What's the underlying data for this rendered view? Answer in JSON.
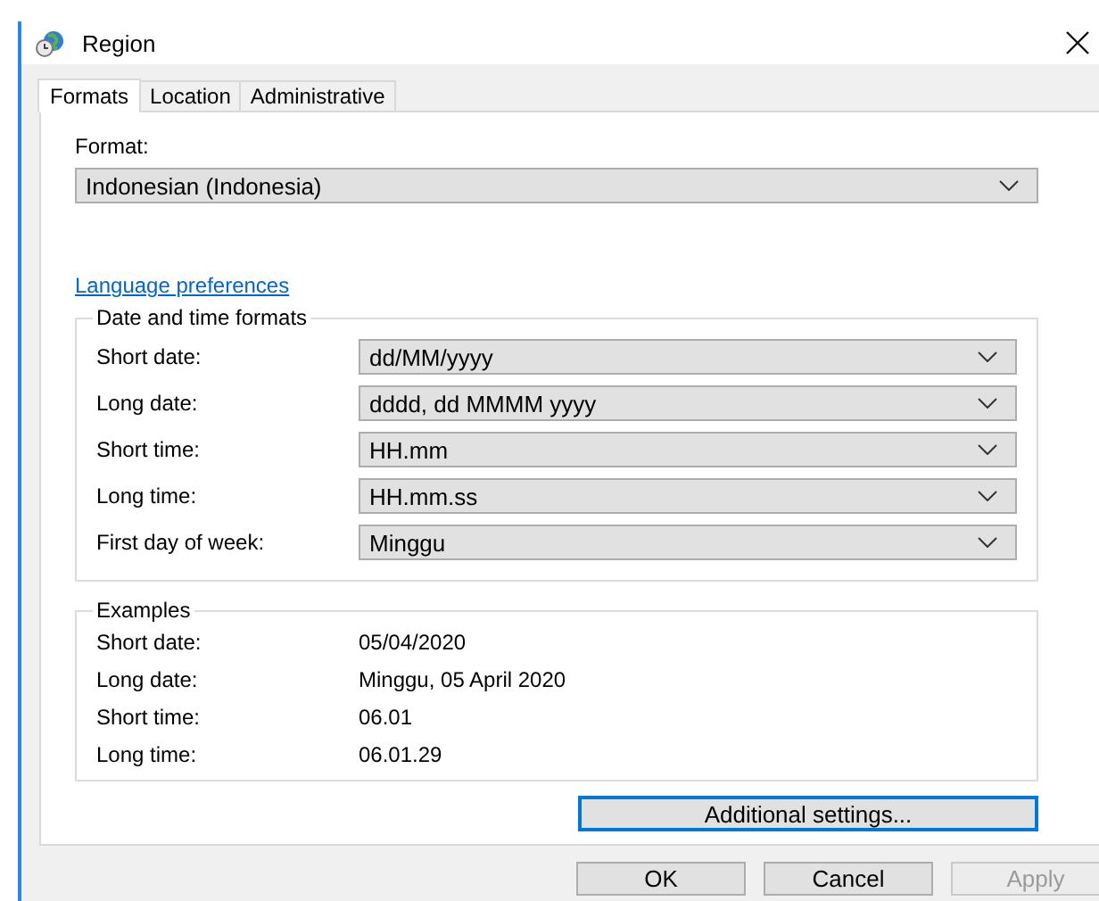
{
  "window": {
    "title": "Region"
  },
  "tabs": [
    {
      "label": "Formats",
      "selected": true
    },
    {
      "label": "Location",
      "selected": false
    },
    {
      "label": "Administrative",
      "selected": false
    }
  ],
  "format": {
    "label": "Format:",
    "value": "Indonesian (Indonesia)"
  },
  "link": "Language preferences",
  "date_time_formats": {
    "title": "Date and time formats",
    "rows": [
      {
        "label": "Short date:",
        "value": "dd/MM/yyyy"
      },
      {
        "label": "Long date:",
        "value": "dddd, dd MMMM yyyy"
      },
      {
        "label": "Short time:",
        "value": "HH.mm"
      },
      {
        "label": "Long time:",
        "value": "HH.mm.ss"
      },
      {
        "label": "First day of week:",
        "value": "Minggu"
      }
    ]
  },
  "examples": {
    "title": "Examples",
    "rows": [
      {
        "label": "Short date:",
        "value": "05/04/2020"
      },
      {
        "label": "Long date:",
        "value": "Minggu, 05 April 2020"
      },
      {
        "label": "Short time:",
        "value": "06.01"
      },
      {
        "label": "Long time:",
        "value": "06.01.29"
      }
    ]
  },
  "additional_settings": {
    "label": "Additional settings...",
    "focused": true
  },
  "buttons": [
    {
      "label": "OK",
      "disabled": false
    },
    {
      "label": "Cancel",
      "disabled": false
    },
    {
      "label": "Apply",
      "disabled": true
    }
  ]
}
